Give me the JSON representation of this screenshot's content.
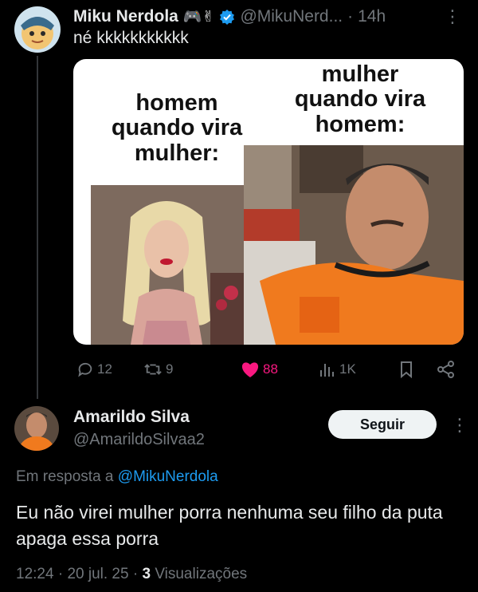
{
  "tweet": {
    "author": {
      "name": "Miku Nerdola",
      "emojis": "🎮✌",
      "handle": "@MikuNerd...",
      "verified": true,
      "avatar_icon": "anime-avatar"
    },
    "time": "14h",
    "separator": "·",
    "text": "né kkkkkkkkkkk",
    "meme": {
      "caption_left": "homem\nquando vira\nmulher:",
      "caption_right": "mulher\nquando vira\nhomem:"
    },
    "actions": {
      "replies": "12",
      "retweets": "9",
      "likes": "88",
      "views": "1K"
    },
    "colors": {
      "like": "#f91880",
      "muted": "#71767b",
      "link": "#1d9bf0"
    }
  },
  "reply": {
    "author": {
      "name": "Amarildo Silva",
      "handle": "@AmarildoSilvaa2"
    },
    "follow_label": "Seguir",
    "reply_to_prefix": "Em resposta a",
    "reply_to_mention": "@MikuNerdola",
    "text": "Eu não virei mulher porra nenhuma seu filho da puta apaga essa porra",
    "time": "12:24",
    "date": "20 jul. 25",
    "views_count": "3",
    "views_label": "Visualizações",
    "separator": "·"
  }
}
